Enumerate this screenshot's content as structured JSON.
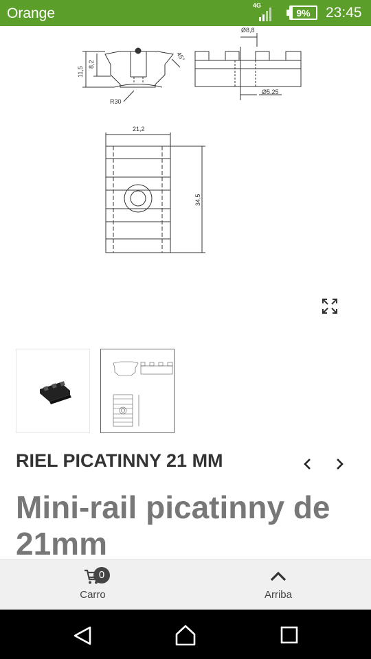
{
  "status_bar": {
    "carrier": "Orange",
    "network_type": "4G",
    "battery": "9%",
    "battery_level": 0.09,
    "time": "23:45",
    "background_color": "#5c9e2a"
  },
  "drawing": {
    "dim_diameter_top": "Ø8,8",
    "dim_height_outer": "11,5",
    "dim_height_inner": "8,2",
    "dim_angle": "45°",
    "dim_radius": "R30",
    "dim_diameter_bottom": "Ø5,25",
    "dim_width": "21,2",
    "dim_length": "34,5"
  },
  "gallery": {
    "expand_icon": "expand-icon",
    "thumbnails": [
      {
        "name": "thumbnail-photo",
        "selected": false
      },
      {
        "name": "thumbnail-drawing",
        "selected": true
      }
    ]
  },
  "product": {
    "category_title": "RIEL PICATINNY 21 MM",
    "name": "Mini-rail picatinny de 21mm",
    "prev_icon": "chevron-left-icon",
    "next_icon": "chevron-right-icon"
  },
  "bottom_bar": {
    "cart_label": "Carro",
    "cart_count": "0",
    "top_label": "Arriba"
  },
  "android_nav": {
    "back_icon": "back-icon",
    "home_icon": "home-icon",
    "recents_icon": "recents-icon"
  }
}
